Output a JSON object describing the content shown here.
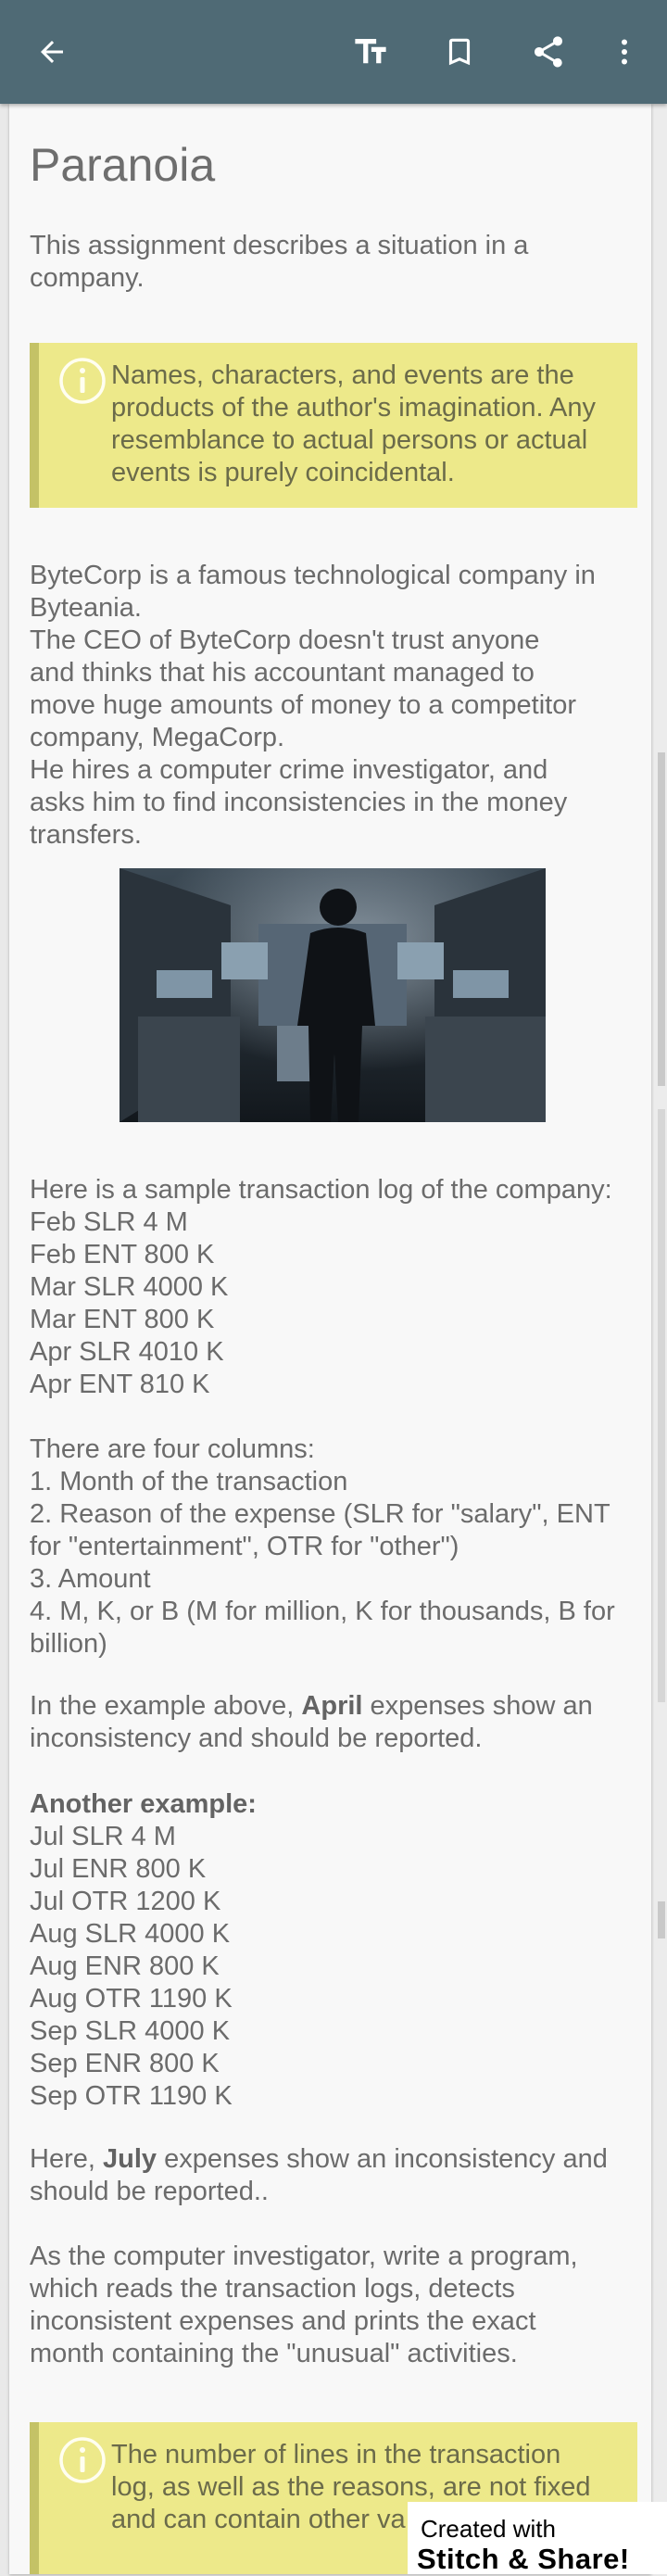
{
  "appbar": {
    "back_icon": "arrow-left-icon",
    "text_size_icon": "text-size-icon",
    "bookmark_icon": "bookmark-icon",
    "share_icon": "share-icon",
    "more_icon": "more-vertical-icon",
    "color": "#4f6a75"
  },
  "article": {
    "title": "Paranoia",
    "intro": [
      "This assignment describes a situation in a",
      "company."
    ],
    "callout1": [
      "Names, characters, and events are the",
      "products of the author's imagination. Any",
      "resemblance to actual persons or actual",
      "events is purely coincidental."
    ],
    "story": [
      "ByteCorp is a famous technological company in",
      "Byteania.",
      "The CEO of ByteCorp doesn't trust anyone",
      "and thinks that his accountant managed to",
      "move huge amounts of money to a competitor",
      "company, MegaCorp.",
      "He hires a computer crime investigator, and",
      "asks him to find inconsistencies in the money",
      "transfers."
    ],
    "sample": [
      "Here is a sample transaction log of the company:",
      "Feb SLR 4 M",
      "Feb ENT 800 K",
      "Mar SLR 4000 K",
      "Mar ENT 800 K",
      "Apr SLR 4010 K",
      "Apr ENT 810 K"
    ],
    "columns": [
      "There are four columns:",
      "1. Month of the transaction",
      "2. Reason of the expense (SLR for \"salary\", ENT",
      "for \"entertainment\", OTR for \"other\")",
      "3. Amount",
      "4. M, K, or B (M for million, K for thousands, B for",
      "billion)"
    ],
    "example_note": {
      "pre": "In the example above, ",
      "bold": "April",
      "post": " expenses show an",
      "line2": "inconsistency and should be reported."
    },
    "another_title": "Another example:",
    "another": [
      "Jul SLR 4 M",
      "Jul ENR 800 K",
      "Jul OTR 1200 K",
      "Aug SLR 4000 K",
      "Aug ENR 800 K",
      "Aug OTR 1190 K",
      "Sep SLR 4000 K",
      "Sep ENR 800 K",
      "Sep OTR 1190 K"
    ],
    "here_note": {
      "pre": "Here, ",
      "bold": "July",
      "post": " expenses show an inconsistency and",
      "line2": "should be reported.."
    },
    "task": [
      "As the computer investigator, write a program,",
      "which reads the transaction logs, detects",
      "inconsistent expenses and prints the exact",
      "month containing the \"unusual\" activities."
    ],
    "callout2": [
      "The number of lines in the transaction",
      "log, as well as the reasons, are not fixed",
      "and can contain other va"
    ],
    "callout_color": "#ede98a"
  },
  "watermark": {
    "line1": "Created with",
    "line2": "Stitch & Share!"
  }
}
